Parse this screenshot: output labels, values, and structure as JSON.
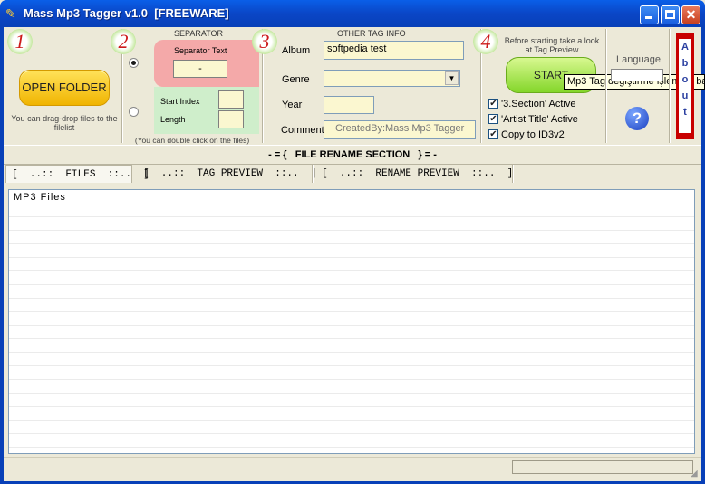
{
  "window": {
    "title": "Mass Mp3 Tagger v1.0  [FREEWARE]"
  },
  "steps": {
    "s1": "1",
    "s2": "2",
    "s3": "3",
    "s4": "4"
  },
  "open_folder": {
    "label": "OPEN FOLDER",
    "hint": "You can drag-drop files to the filelist"
  },
  "separator": {
    "heading": "SEPARATOR",
    "text_label": "Separator Text",
    "text_value": "-",
    "start_index_label": "Start Index",
    "length_label": "Length",
    "hint": "(You can double click on the files)"
  },
  "other_tag": {
    "heading": "OTHER TAG INFO",
    "album_label": "Album",
    "album_value": "softpedia test",
    "genre_label": "Genre",
    "year_label": "Year",
    "comment_label": "Comment",
    "comment_value": "CreatedBy:Mass Mp3 Tagger"
  },
  "start": {
    "hint": "Before starting take a look at Tag Preview",
    "label": "START",
    "tooltip": "Mp3 Tag değiştirme işlemine baş"
  },
  "options": [
    {
      "label": "'3.Section' Active",
      "checked": true
    },
    {
      "label": "'Artist  Title' Active",
      "checked": true
    },
    {
      "label": "Copy to ID3v2",
      "checked": true
    }
  ],
  "language": {
    "label": "Language"
  },
  "about": {
    "letters": [
      "A",
      "b",
      "o",
      "u",
      "t"
    ]
  },
  "section_bar": "- = {   FILE RENAME SECTION   } = -",
  "tabs": [
    {
      "label": "[  ..::  FILES  ::..  ]"
    },
    {
      "label": "[  ..::  TAG PREVIEW  ::..  ]"
    },
    {
      "label": "[  ..::  RENAME PREVIEW  ::..  ]"
    }
  ],
  "filelist": {
    "header": "MP3 Files"
  },
  "colors": {
    "titlebar": "#0a46c6",
    "accent_red": "#cc1a1a",
    "start_green": "#84d62a",
    "open_yellow": "#f0b400"
  }
}
